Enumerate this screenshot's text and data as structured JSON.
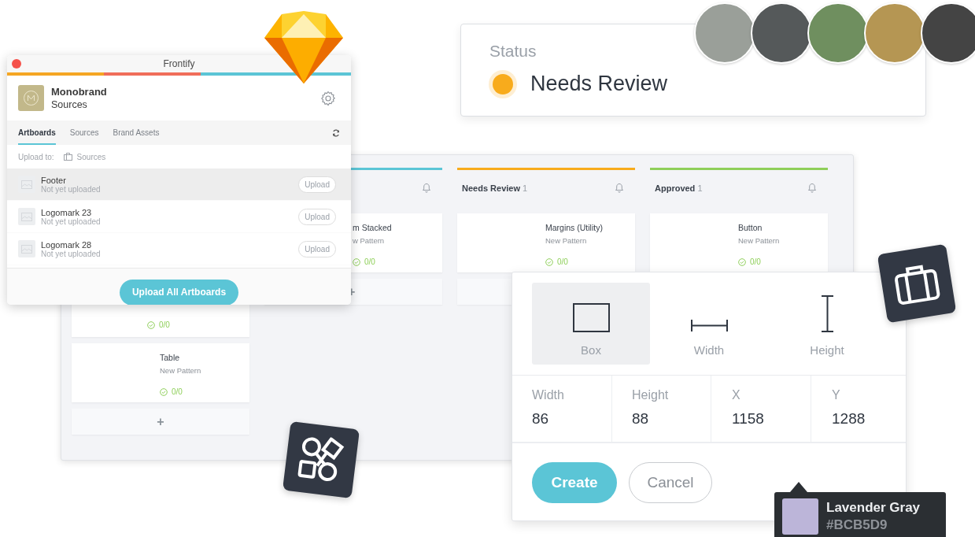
{
  "status_card": {
    "label": "Status",
    "value": "Needs Review",
    "color": "#f8ab1c"
  },
  "avatars": [
    {
      "kind": "photo"
    },
    {
      "kind": "photo"
    },
    {
      "kind": "photo"
    },
    {
      "kind": "photo"
    },
    {
      "kind": "photo"
    }
  ],
  "board": {
    "columns": [
      {
        "cards": [
          {
            "count": "0/0"
          },
          {
            "title": "Table",
            "subtitle": "New Pattern",
            "count": "0/0"
          }
        ],
        "add": "+"
      },
      {
        "color": "#5bc5d6",
        "cards": [
          {
            "title": "m Stacked",
            "subtitle": "w Pattern",
            "count": "0/0"
          }
        ],
        "add": "+"
      },
      {
        "color": "#f8ab1c",
        "title": "Needs Review",
        "count": "1",
        "cards": [
          {
            "title": "Margins (Utility)",
            "subtitle": "New Pattern",
            "count": "0/0"
          }
        ]
      },
      {
        "color": "#8fcf5a",
        "title": "Approved",
        "count": "1",
        "cards": [
          {
            "title": "Button",
            "subtitle": "New Pattern",
            "count": "0/0"
          }
        ]
      }
    ]
  },
  "plugin_window": {
    "title": "Frontify",
    "brand": {
      "name": "Monobrand",
      "section": "Sources"
    },
    "tabs": [
      {
        "label": "Artboards",
        "selected": true
      },
      {
        "label": "Sources",
        "selected": false
      },
      {
        "label": "Brand Assets",
        "selected": false
      }
    ],
    "upload_to": {
      "label": "Upload to:",
      "target": "Sources"
    },
    "artboards": [
      {
        "name": "Footer",
        "status": "Not yet uploaded",
        "action": "Upload",
        "selected": true
      },
      {
        "name": "Logomark 23",
        "status": "Not yet uploaded",
        "action": "Upload",
        "selected": false
      },
      {
        "name": "Logomark 28",
        "status": "Not yet uploaded",
        "action": "Upload",
        "selected": false
      }
    ],
    "upload_all": "Upload All Artboards"
  },
  "shape_panel": {
    "tools": [
      {
        "kind": "box",
        "label": "Box",
        "selected": true
      },
      {
        "kind": "width",
        "label": "Width",
        "selected": false
      },
      {
        "kind": "height",
        "label": "Height",
        "selected": false
      }
    ],
    "fields": [
      {
        "label": "Width",
        "value": "86"
      },
      {
        "label": "Height",
        "value": "88"
      },
      {
        "label": "X",
        "value": "1158"
      },
      {
        "label": "Y",
        "value": "1288"
      }
    ],
    "create": "Create",
    "cancel": "Cancel"
  },
  "color_tooltip": {
    "name": "Lavender Gray",
    "hex": "#BCB5D9",
    "color": "#bcb5d9"
  }
}
